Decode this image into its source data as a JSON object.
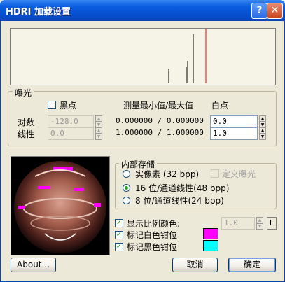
{
  "window": {
    "title": "HDRI 加载设置",
    "help_glyph": "?",
    "close_glyph": "✕"
  },
  "exposure": {
    "group_title": "曝光",
    "black_point_label": "黑点",
    "black_point_checked": false,
    "measure_header": "测量最小值/最大值",
    "white_point_header": "白点",
    "rows": [
      {
        "label": "对数",
        "black_value": "-128.0",
        "measure": "0.000000 / 0.000000",
        "white_value": "0.0"
      },
      {
        "label": "线性",
        "black_value": "0.0",
        "measure": "1.000000 / 1.000000",
        "white_value": "1.0"
      }
    ]
  },
  "storage": {
    "group_title": "内部存储",
    "options": [
      {
        "label": "实像素 (32 bpp)",
        "selected": false
      },
      {
        "label": "16 位/通道线性(48 bpp)",
        "selected": true
      },
      {
        "label": "8 位/通道线性(24 bpp)",
        "selected": false
      }
    ],
    "def_exposure_label": "定义曝光",
    "def_exposure_checked": false
  },
  "display": {
    "scale_label": "显示比例颜色:",
    "scale_checked": true,
    "scale_value": "1.0",
    "scale_unit": "L",
    "white_clamp_label": "标记白色钳位",
    "white_clamp_checked": true,
    "white_clamp_color": "#ff00ff",
    "black_clamp_label": "标记黑色钳位",
    "black_clamp_checked": true,
    "black_clamp_color": "#00ffff"
  },
  "buttons": {
    "about": "About...",
    "cancel": "取消",
    "ok": "确定"
  },
  "colors": {
    "title_bar": "#0550d0",
    "dialog_bg": "#ece9d8",
    "histogram_marker": "#ff0000"
  }
}
